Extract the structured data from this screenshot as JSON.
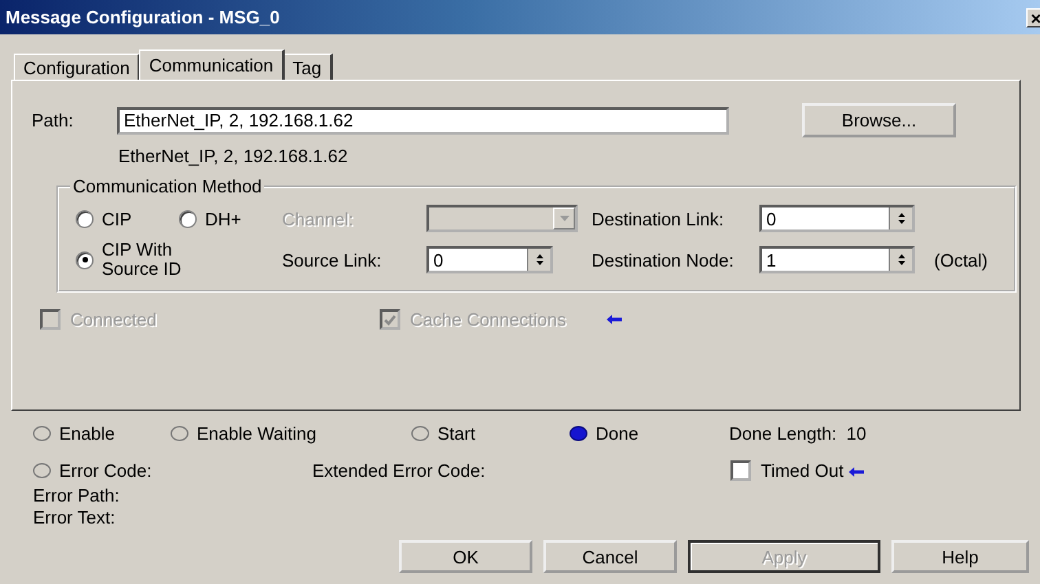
{
  "window": {
    "title": "Message Configuration - MSG_0",
    "close": "×"
  },
  "tabs": [
    {
      "label": "Configuration",
      "selected": false
    },
    {
      "label": "Communication",
      "selected": true
    },
    {
      "label": "Tag",
      "selected": false
    }
  ],
  "path": {
    "label": "Path:",
    "value": "EtherNet_IP, 2, 192.168.1.62",
    "resolved": "EtherNet_IP, 2, 192.168.1.62",
    "browse_button": "Browse..."
  },
  "communication_method": {
    "title": "Communication Method",
    "options": [
      {
        "label": "CIP",
        "selected": false
      },
      {
        "label": "DH+",
        "selected": false
      },
      {
        "label": "CIP With Source ID",
        "selected": true
      }
    ],
    "channel": {
      "label": "Channel:",
      "disabled": true
    },
    "source_link": {
      "label": "Source Link:",
      "value": "0"
    },
    "destination_link": {
      "label": "Destination Link:",
      "value": "0"
    },
    "destination_node": {
      "label": "Destination Node:",
      "value": "1",
      "unit": "(Octal)"
    }
  },
  "options": [
    {
      "label": "Connected",
      "checked": false,
      "disabled": true,
      "arrow": false
    },
    {
      "label": "Cache Connections",
      "checked": true,
      "disabled": true,
      "arrow": true
    }
  ],
  "status": {
    "indicators": [
      {
        "label": "Enable",
        "on": false
      },
      {
        "label": "Enable Waiting",
        "on": false
      },
      {
        "label": "Start",
        "on": false
      },
      {
        "label": "Done",
        "on": true
      }
    ],
    "done_length": "Done Length:  10",
    "error_code": {
      "label": "Error Code:",
      "on": false
    },
    "extended_error_code": "Extended Error Code:",
    "timed_out": {
      "label": "Timed Out",
      "checked": false,
      "arrow": true
    },
    "error_path": "Error Path:",
    "error_text": "Error Text:"
  },
  "buttons": [
    {
      "label": "OK",
      "disabled": false,
      "focused": false
    },
    {
      "label": "Cancel",
      "disabled": false,
      "focused": false
    },
    {
      "label": "Apply",
      "disabled": true,
      "focused": true
    },
    {
      "label": "Help",
      "disabled": false,
      "focused": false
    }
  ]
}
